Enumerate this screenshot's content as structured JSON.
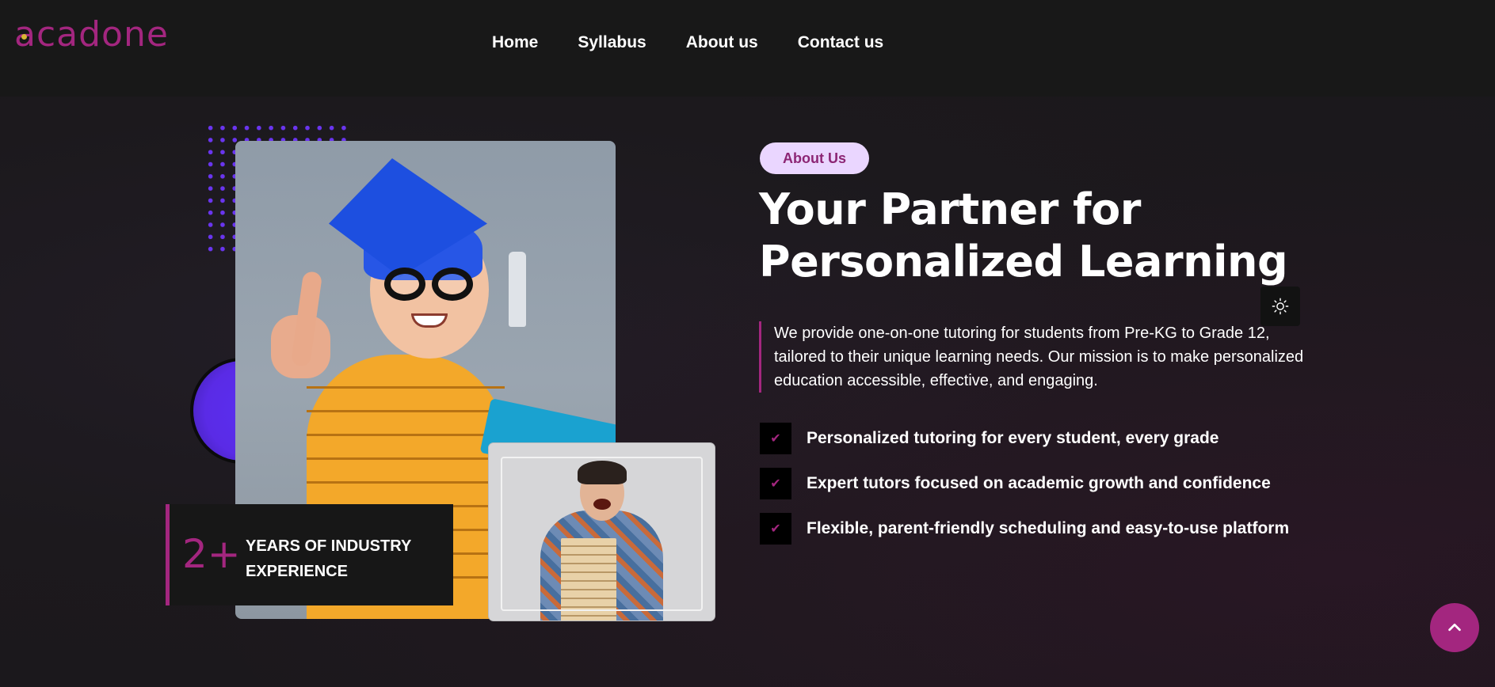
{
  "header": {
    "logo_text": "acadone",
    "nav": [
      {
        "label": "Home"
      },
      {
        "label": "Syllabus"
      },
      {
        "label": "About us"
      },
      {
        "label": "Contact us"
      }
    ]
  },
  "hero": {
    "badge": "About Us",
    "title_part1": "Your Partner ",
    "title_highlight": "for",
    "title_part2": "Personalized Learning",
    "description": "We provide one-on-one tutoring for students from Pre-KG to Grade 12, tailored to their unique learning needs. Our mission is to make personalized education accessible, effective, and engaging.",
    "features": [
      {
        "label": "Personalized tutoring for every student, every grade"
      },
      {
        "label": "Expert tutors focused on academic growth and confidence"
      },
      {
        "label": "Flexible, parent-friendly scheduling and easy-to-use platform"
      }
    ],
    "experience": {
      "number": "2+",
      "text": "YEARS OF INDUSTRY EXPERIENCE"
    }
  },
  "icons": {
    "check": "check-icon",
    "theme": "sun-icon",
    "scroll": "chevron-up-icon"
  },
  "colors": {
    "brand": "#a3267f",
    "badge_bg": "#ead6ff",
    "highlight": "#d3a223",
    "dots": "#6a35f0"
  }
}
